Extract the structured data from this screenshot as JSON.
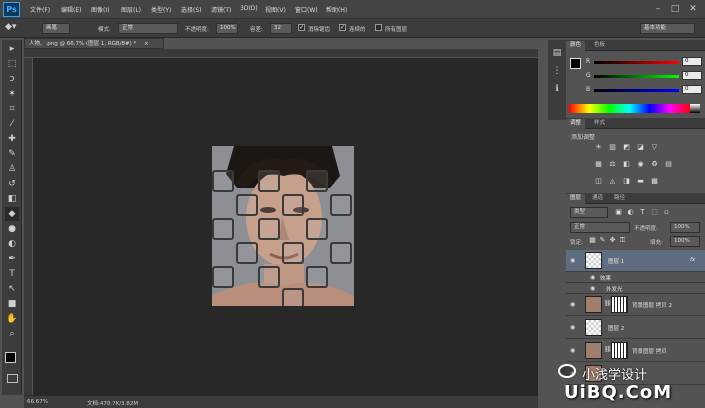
{
  "app": {
    "logo": "Ps"
  },
  "menu": [
    "文件(F)",
    "编辑(E)",
    "图像(I)",
    "图层(L)",
    "类型(Y)",
    "选择(S)",
    "滤镜(T)",
    "3D(D)",
    "视图(V)",
    "窗口(W)",
    "帮助(H)"
  ],
  "window_controls": [
    "–",
    "□",
    "✕"
  ],
  "options": {
    "preset": "画笔",
    "mode_label": "模式:",
    "mode_value": "正常",
    "opacity_label": "不透明度:",
    "opacity_value": "100%",
    "tolerance_label": "容差:",
    "tolerance_value": "32",
    "antialias_label": "消除锯齿",
    "contiguous_label": "连续的",
    "all_layers_label": "所有图层",
    "workspace": "基本功能"
  },
  "document": {
    "tab": "人物、.png @ 66.7% (图层 1, RGB/8#) *",
    "close": "×"
  },
  "status": {
    "zoom": "66.67%",
    "doc_size": "文档:470.7K/3.82M"
  },
  "tools": [
    "move-icon",
    "marquee-icon",
    "lasso-icon",
    "magic-wand-icon",
    "crop-icon",
    "eyedropper-icon",
    "healing-icon",
    "brush-icon",
    "stamp-icon",
    "history-brush-icon",
    "eraser-icon",
    "paint-bucket-icon",
    "blur-icon",
    "dodge-icon",
    "pen-icon",
    "text-icon",
    "path-select-icon",
    "shape-icon",
    "hand-icon",
    "zoom-icon"
  ],
  "tool_glyphs": [
    "▸",
    "⬚",
    "ↄ",
    "✶",
    "⌗",
    "⁄",
    "✚",
    "✎",
    "♙",
    "↺",
    "◧",
    "◆",
    "●",
    "◐",
    "✒",
    "T",
    "↖",
    "■",
    "✋",
    "⌕"
  ],
  "color_panel": {
    "tabs": [
      "颜色",
      "色板"
    ],
    "channels": [
      {
        "label": "R",
        "value": "0"
      },
      {
        "label": "G",
        "value": "0"
      },
      {
        "label": "B",
        "value": "0"
      }
    ]
  },
  "adjustments_panel": {
    "tabs": [
      "调整",
      "样式"
    ],
    "title": "添加调整"
  },
  "layers_panel": {
    "tabs": [
      "图层",
      "通道",
      "路径"
    ],
    "filter": "类型",
    "blend_mode": "正常",
    "opacity_label": "不透明度:",
    "opacity_value": "100%",
    "lock_label": "锁定:",
    "fill_label": "填充:",
    "fill_value": "100%",
    "layers": [
      {
        "name": "图层 1",
        "fx": "fx",
        "selected": true
      },
      {
        "name": "效果",
        "sub": true
      },
      {
        "name": "外发光",
        "sub": true
      },
      {
        "name": "背景图层 拷贝 2"
      },
      {
        "name": "图层 2"
      },
      {
        "name": "背景图层 拷贝"
      }
    ]
  },
  "watermark": {
    "text": "小浅学设计",
    "logo_text": "UiBQ.CoM"
  },
  "colors": {
    "accent": "#5f6d80",
    "canvas_bg": "#282828",
    "panel": "#535353"
  }
}
